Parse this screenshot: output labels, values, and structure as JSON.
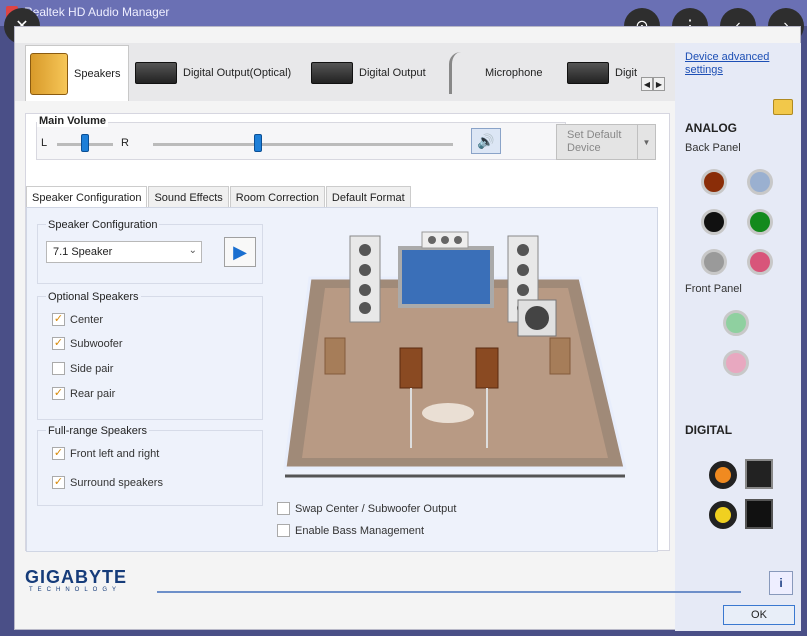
{
  "window": {
    "title": "Realtek HD Audio Manager"
  },
  "overlay": {
    "close": "✕",
    "lens": "⊙",
    "more": "⋮",
    "prev": "‹",
    "next": "›"
  },
  "device_tabs": [
    {
      "label": "Speakers",
      "icon": "speakers-icon"
    },
    {
      "label": "Digital Output(Optical)",
      "icon": "optical-output-icon"
    },
    {
      "label": "Digital Output",
      "icon": "digital-output-icon"
    },
    {
      "label": "Microphone",
      "icon": "microphone-icon"
    },
    {
      "label": "Digit",
      "icon": "digital-icon"
    }
  ],
  "main_volume": {
    "label": "Main Volume",
    "left": "L",
    "right": "R",
    "balance": 0.5,
    "volume": 0.35
  },
  "set_default": {
    "label_line1": "Set Default",
    "label_line2": "Device"
  },
  "sub_tabs": [
    "Speaker Configuration",
    "Sound Effects",
    "Room Correction",
    "Default Format"
  ],
  "speaker_config": {
    "group_label": "Speaker Configuration",
    "selected": "7.1 Speaker"
  },
  "optional_speakers": {
    "label": "Optional Speakers",
    "items": [
      {
        "label": "Center",
        "checked": true
      },
      {
        "label": "Subwoofer",
        "checked": true
      },
      {
        "label": "Side pair",
        "checked": false
      },
      {
        "label": "Rear pair",
        "checked": true
      }
    ]
  },
  "fullrange_speakers": {
    "label": "Full-range Speakers",
    "items": [
      {
        "label": "Front left and right",
        "checked": true
      },
      {
        "label": "Surround speakers",
        "checked": true
      }
    ]
  },
  "bottom_options": [
    {
      "label": "Swap Center / Subwoofer Output",
      "checked": false
    },
    {
      "label": "Enable Bass Management",
      "checked": false
    }
  ],
  "right_panel": {
    "link_line1": "Device advanced",
    "link_line2": "settings",
    "analog": "ANALOG",
    "back_panel": "Back Panel",
    "front_panel": "Front Panel",
    "digital": "DIGITAL",
    "jack_colors": [
      "#8a2d08",
      "#9ab0d0",
      "#111111",
      "#138a1c",
      "#9a9a9a",
      "#d8557a",
      "#8fd0a0",
      "#e8a8c0"
    ]
  },
  "footer": {
    "brand": "GIGABYTE",
    "brand_sub": "TECHNOLOGY",
    "info": "i",
    "ok": "OK"
  },
  "colors": {
    "accent": "#1e7fd8",
    "titlebar": "#6a70b4",
    "link": "#1d4fb5"
  }
}
